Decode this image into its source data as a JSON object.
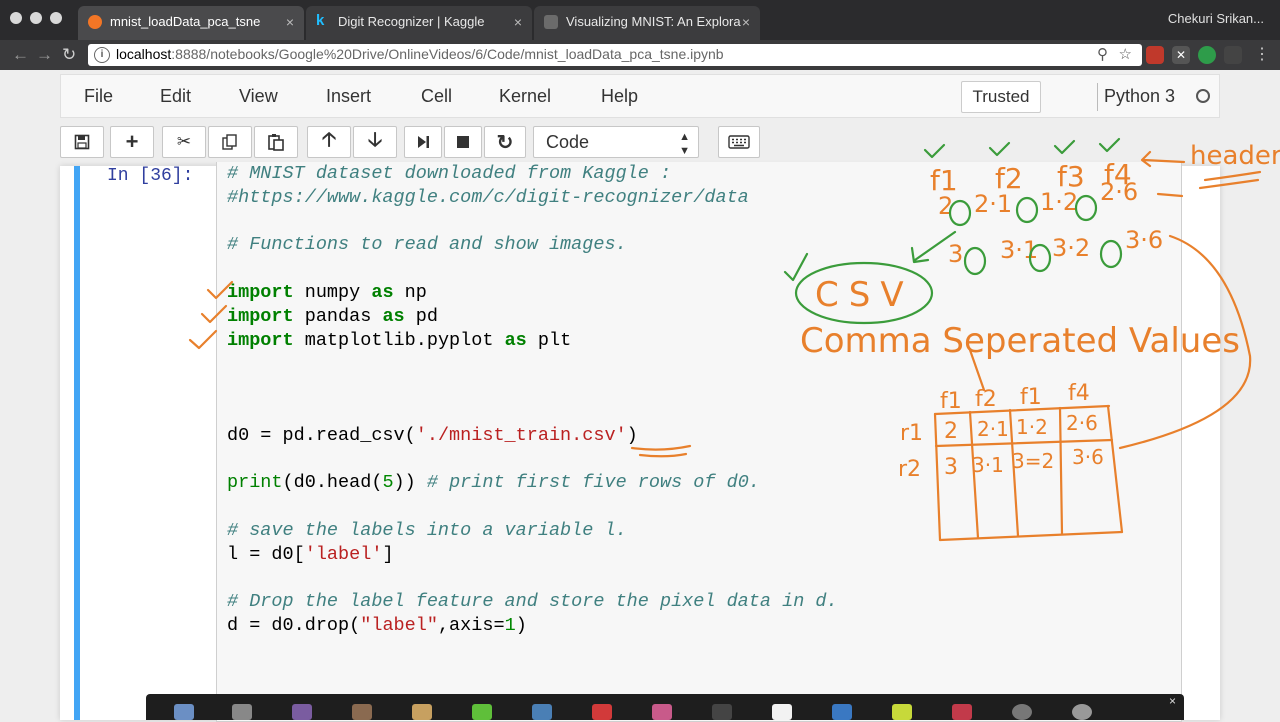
{
  "browser": {
    "tabs": [
      {
        "title": "mnist_loadData_pca_tsne",
        "active": true,
        "favicon_color": "#f37626"
      },
      {
        "title": "Digit Recognizer | Kaggle",
        "active": false,
        "favicon_color": "#20beff"
      },
      {
        "title": "Visualizing MNIST: An Explora",
        "active": false,
        "favicon_color": "#6b6b6b"
      }
    ],
    "tab_close_glyph": "×",
    "profile_name": "Chekuri Srikan...",
    "url_host": "localhost",
    "url_path": ":8888/notebooks/Google%20Drive/OnlineVideos/6/Code/mnist_loadData_pca_tsne.ipynb"
  },
  "jupyter": {
    "menu": [
      "File",
      "Edit",
      "View",
      "Insert",
      "Cell",
      "Kernel",
      "Help"
    ],
    "trusted_label": "Trusted",
    "kernel_name": "Python 3",
    "toolbar": {
      "cell_type": "Code",
      "buttons": [
        "save-icon",
        "plus-icon",
        "cut-icon",
        "copy-icon",
        "paste-icon",
        "arrow-up-icon",
        "arrow-down-icon",
        "step-forward-icon",
        "stop-icon",
        "restart-icon",
        "keyboard-icon"
      ]
    },
    "cell": {
      "prompt": "In [36]:",
      "code_lines": [
        "# MNIST dataset downloaded from Kaggle :",
        "#https://www.kaggle.com/c/digit-recognizer/data",
        "",
        "# Functions to read and show images.",
        "",
        "import numpy as np",
        "import pandas as pd",
        "import matplotlib.pyplot as plt",
        "",
        "",
        "",
        "d0 = pd.read_csv('./mnist_train.csv')",
        "",
        "print(d0.head(5)) # print first five rows of d0.",
        "",
        "# save the labels into a variable l.",
        "l = d0['label']",
        "",
        "# Drop the label feature and store the pixel data in d.",
        "d = d0.drop(\"label\",axis=1)"
      ]
    }
  },
  "annotations": {
    "header_word": "header",
    "csv_word": "CSV",
    "csv_expansion": "Comma Seperated Values",
    "features": [
      "f1",
      "f2",
      "f3",
      "f4"
    ],
    "row1": [
      "2",
      "2·1",
      "1·2",
      "2·6"
    ],
    "row2": [
      "3",
      "3·1",
      "3·2",
      "3·6"
    ],
    "table_header": [
      "f1",
      "f2",
      "f1",
      "f4"
    ],
    "table_rows": [
      {
        "label": "r1",
        "cells": [
          "2",
          "2·1",
          "1·2",
          "2·6"
        ]
      },
      {
        "label": "r2",
        "cells": [
          "3",
          "3·1",
          "3=2",
          "3·6"
        ]
      }
    ],
    "ink_color": "#e8802c",
    "marker_color": "#3b9c3b"
  },
  "dock": {
    "close_glyph": "×"
  }
}
